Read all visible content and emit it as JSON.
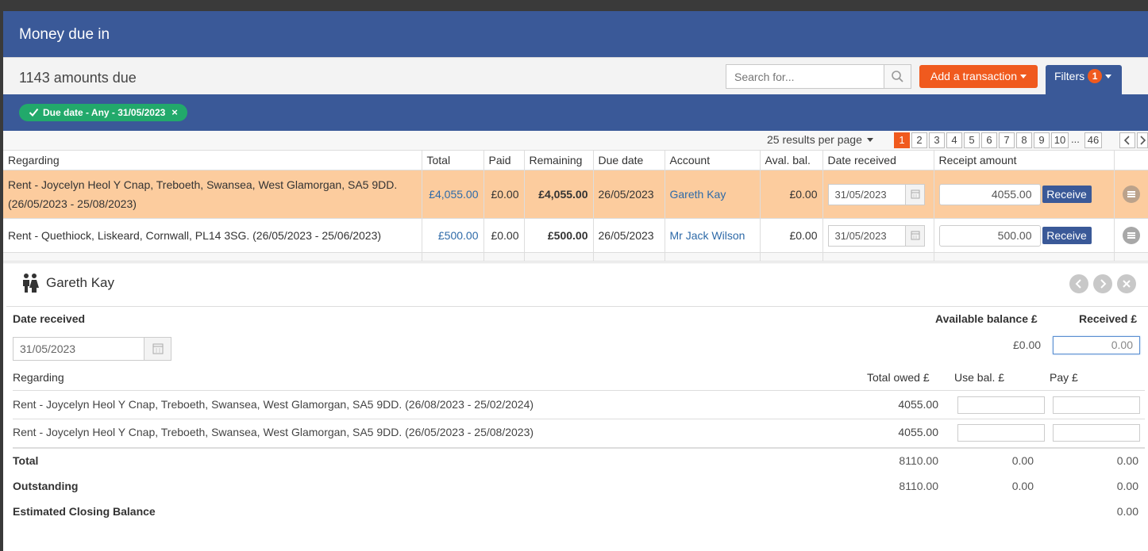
{
  "header": {
    "title": "Money due in"
  },
  "subbar": {
    "count_text": "1143 amounts due",
    "search_placeholder": "Search for...",
    "add_label": "Add a transaction",
    "filters_label": "Filters",
    "filters_count": "1"
  },
  "filter_chip": {
    "label": "Due date - Any - 31/05/2023",
    "close": "×"
  },
  "pager": {
    "per_page": "25 results per page",
    "pages": [
      "1",
      "2",
      "3",
      "4",
      "5",
      "6",
      "7",
      "8",
      "9",
      "10"
    ],
    "ellipsis": "...",
    "last": "46",
    "active_page": "1"
  },
  "table": {
    "columns": [
      "Regarding",
      "Total",
      "Paid",
      "Remaining",
      "Due date",
      "Account",
      "Aval. bal.",
      "Date received",
      "Receipt amount"
    ],
    "rows": [
      {
        "regarding": "Rent - Joycelyn Heol Y Cnap, Treboeth, Swansea, West Glamorgan, SA5 9DD. (26/05/2023 - 25/08/2023)",
        "total": "£4,055.00",
        "paid": "£0.00",
        "remaining": "£4,055.00",
        "due_date": "26/05/2023",
        "account": "Gareth Kay",
        "aval_bal": "£0.00",
        "date_received": "31/05/2023",
        "receipt_amount": "4055.00",
        "receive_label": "Receive"
      },
      {
        "regarding": "Rent - Quethiock, Liskeard, Cornwall, PL14 3SG. (26/05/2023 - 25/06/2023)",
        "total": "£500.00",
        "paid": "£0.00",
        "remaining": "£500.00",
        "due_date": "26/05/2023",
        "account": "Mr Jack Wilson",
        "aval_bal": "£0.00",
        "date_received": "31/05/2023",
        "receipt_amount": "500.00",
        "receive_label": "Receive"
      }
    ]
  },
  "panel": {
    "title": "Gareth Kay",
    "date_received_label": "Date received",
    "date_received_value": "31/05/2023",
    "available_balance_label": "Available balance £",
    "available_balance_value": "£0.00",
    "received_label": "Received £",
    "received_placeholder": "0.00",
    "regarding_label": "Regarding",
    "total_owed_label": "Total owed £",
    "use_bal_label": "Use bal. £",
    "pay_label": "Pay £",
    "items": [
      {
        "regarding": "Rent - Joycelyn Heol Y Cnap, Treboeth, Swansea, West Glamorgan, SA5 9DD. (26/08/2023 - 25/02/2024)",
        "owed": "4055.00"
      },
      {
        "regarding": "Rent - Joycelyn Heol Y Cnap, Treboeth, Swansea, West Glamorgan, SA5 9DD. (26/05/2023 - 25/08/2023)",
        "owed": "4055.00"
      }
    ],
    "total": {
      "label": "Total",
      "owed": "8110.00",
      "use_bal": "0.00",
      "pay": "0.00"
    },
    "outstanding": {
      "label": "Outstanding",
      "owed": "8110.00",
      "use_bal": "0.00",
      "pay": "0.00"
    },
    "closing": {
      "label": "Estimated Closing Balance",
      "pay": "0.00"
    }
  },
  "colors": {
    "brand_blue": "#3a5998",
    "accent_orange": "#f05a1e",
    "chip_green": "#22a96b",
    "highlight_row": "#fccc9e"
  }
}
